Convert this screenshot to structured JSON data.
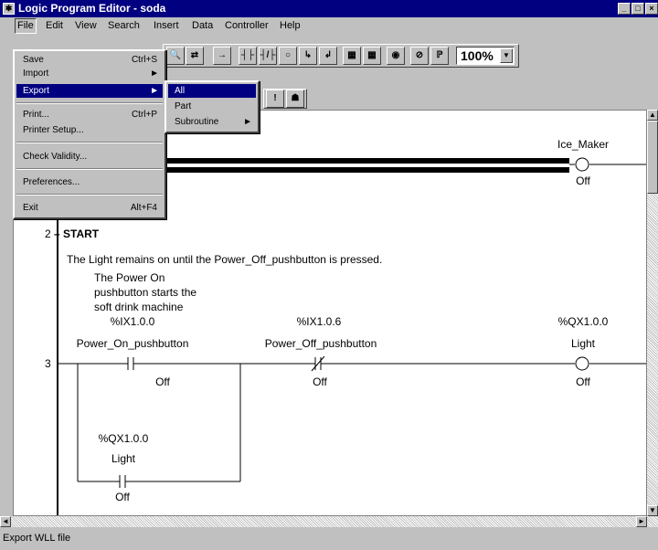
{
  "window": {
    "title": "Logic Program Editor - soda"
  },
  "menubar": [
    "File",
    "Edit",
    "View",
    "Search",
    "Insert",
    "Data",
    "Controller",
    "Help"
  ],
  "toolbar": {
    "zoom": "100%"
  },
  "file_menu": {
    "save": "Save",
    "save_acc": "Ctrl+S",
    "import": "Import",
    "export": "Export",
    "print": "Print...",
    "print_acc": "Ctrl+P",
    "printer_setup": "Printer Setup...",
    "check_validity": "Check Validity...",
    "preferences": "Preferences...",
    "exit": "Exit",
    "exit_acc": "Alt+F4"
  },
  "export_menu": {
    "all": "All",
    "part": "Part",
    "subroutine": "Subroutine"
  },
  "ladder": {
    "rung1_coil": "Ice_Maker",
    "rung1_state": "Off",
    "rung2_num": "2",
    "rung2_title": "START",
    "rung2_comment": "The Light remains on until the Power_Off_pushbutton is pressed.",
    "rung3_num": "3",
    "rung3_note1": "The Power On",
    "rung3_note2": "pushbutton starts the",
    "rung3_note3": "soft drink machine",
    "c1_addr": "%IX1.0.0",
    "c1_name": "Power_On_pushbutton",
    "c1_state": "Off",
    "c2_addr": "%IX1.0.6",
    "c2_name": "Power_Off_pushbutton",
    "c2_state": "Off",
    "coil_addr": "%QX1.0.0",
    "coil_name": "Light",
    "coil_state": "Off",
    "branch_addr": "%QX1.0.0",
    "branch_name": "Light",
    "branch_state": "Off"
  },
  "status": {
    "text": "Export WLL file"
  }
}
